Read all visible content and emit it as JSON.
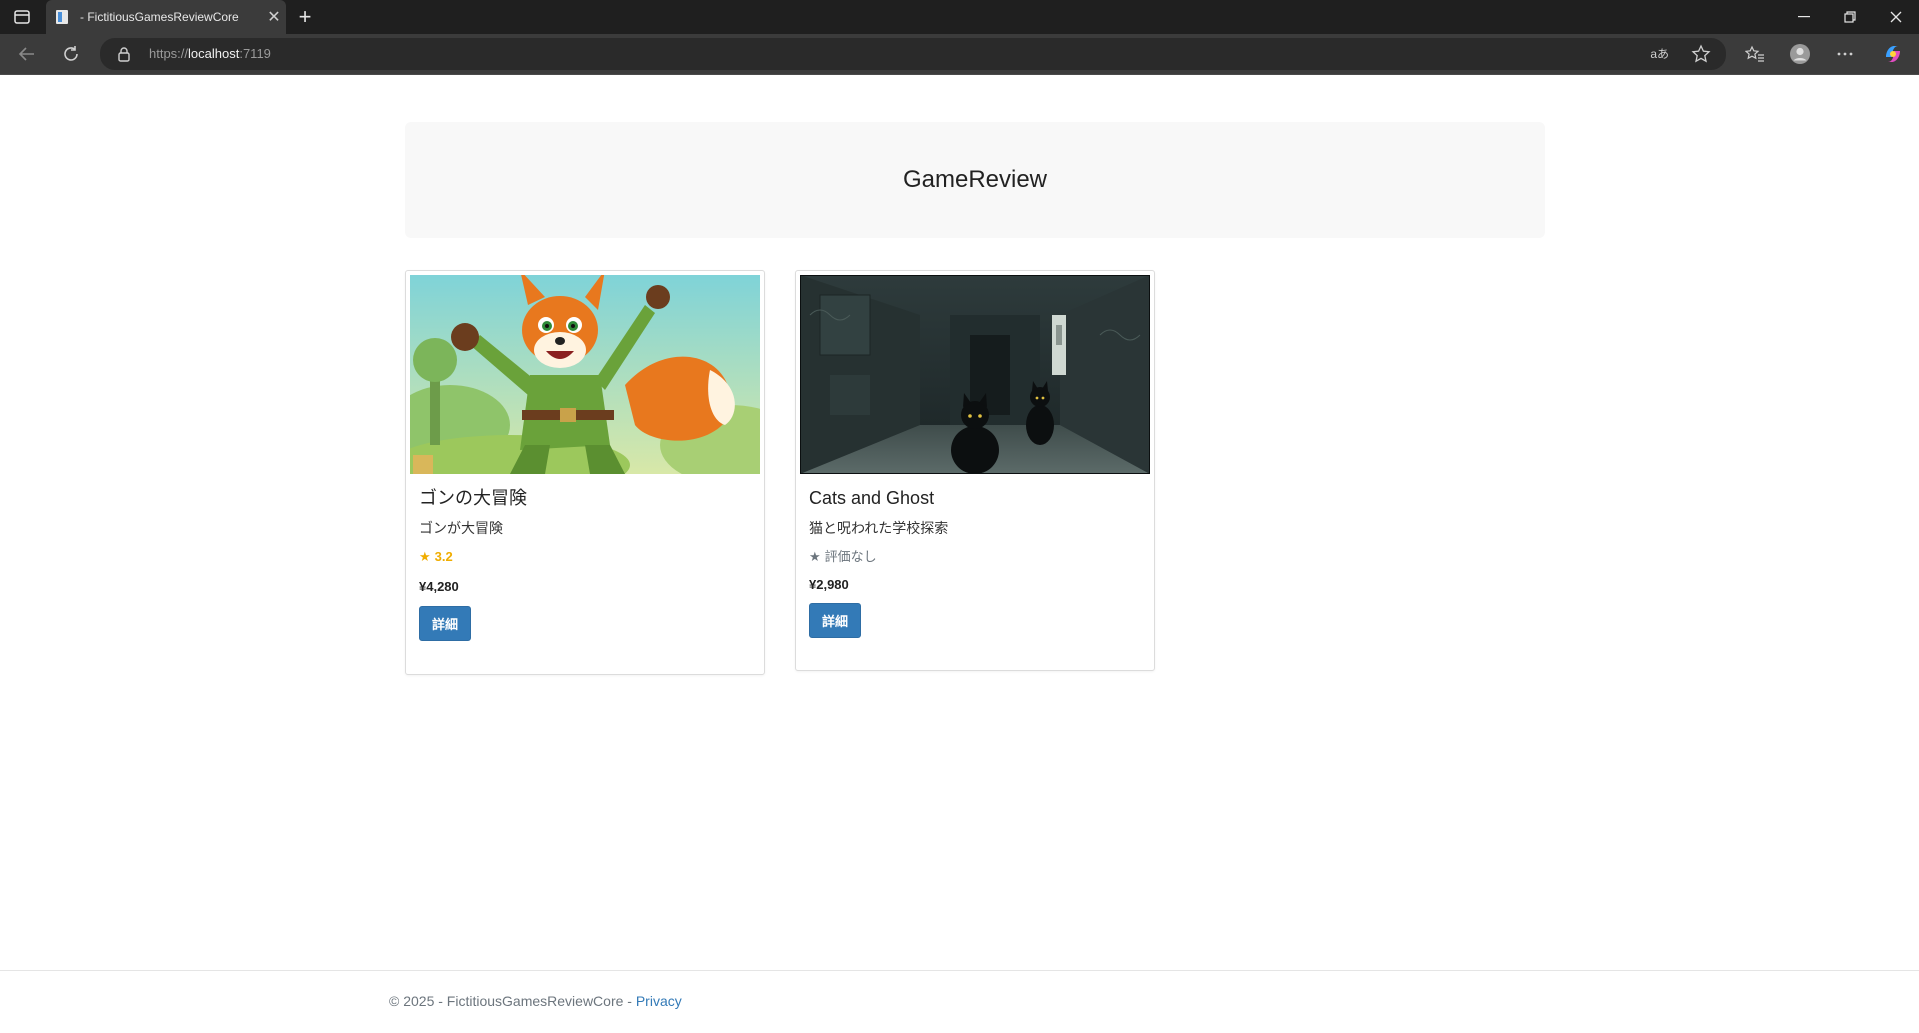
{
  "browser": {
    "tab_title": "- FictitiousGamesReviewCore",
    "new_tab_symbol": "+",
    "url_scheme": "https://",
    "url_host": "localhost",
    "url_port": ":7119",
    "read_aloud_label": "aあ"
  },
  "page": {
    "heading": "GameReview"
  },
  "games": [
    {
      "title": "ゴンの大冒険",
      "description": "ゴンが大冒険",
      "rating_star": "★",
      "rating": "3.2",
      "price": "¥4,280",
      "details_button": "詳細",
      "image_description": "cartoon fox adventurer"
    },
    {
      "title": "Cats and Ghost",
      "description": "猫と呪われた学校探索",
      "rating_star": "★",
      "rating": "評価なし",
      "price": "¥2,980",
      "details_button": "詳細",
      "image_description": "black cats in dark abandoned school corridor"
    }
  ],
  "footer": {
    "copyright": "© 2025 - FictitiousGamesReviewCore - ",
    "privacy_link": "Privacy"
  },
  "colors": {
    "primary": "#337ab7",
    "star": "#f0ad00"
  }
}
